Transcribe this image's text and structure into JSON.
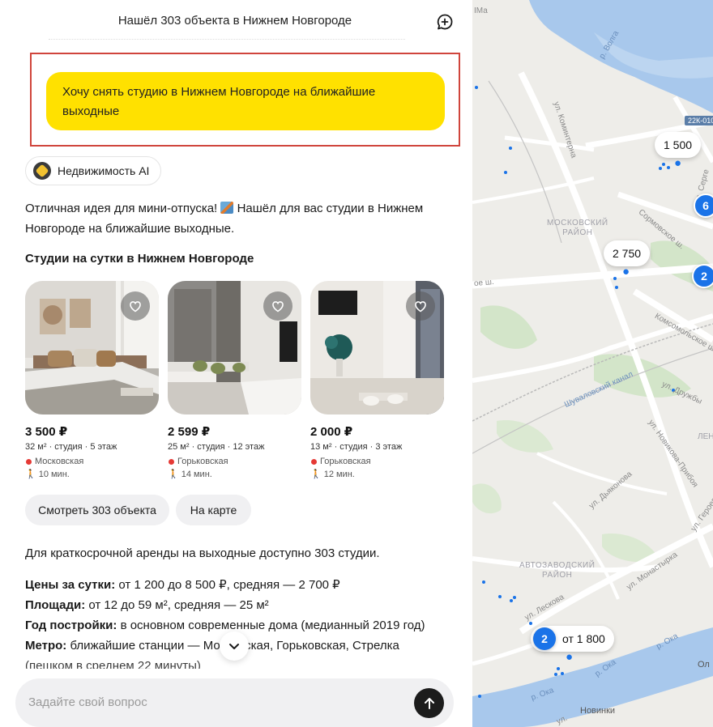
{
  "header": {
    "title": "Нашёл 303 объекта в Нижнем Новгороде"
  },
  "user_message": "Хочу снять студию в Нижнем Новгороде на ближайшие выходные",
  "source_chip": "Недвижимость AI",
  "assistant": {
    "intro_before_emoji": "Отличная идея для мини-отпуска!",
    "intro_after_emoji": "Нашёл для вас студии в Нижнем Новгороде на ближайшие выходные.",
    "section_title": "Студии на сутки в Нижнем Новгороде"
  },
  "listings": [
    {
      "price": "3 500 ₽",
      "meta": "32 м² · студия · 5 этаж",
      "metro": "Московская",
      "walk": "10 мин."
    },
    {
      "price": "2 599 ₽",
      "meta": "25 м² · студия · 12 этаж",
      "metro": "Горьковская",
      "walk": "14 мин."
    },
    {
      "price": "2 000 ₽",
      "meta": "13 м² · студия · 3 этаж",
      "metro": "Горьковская",
      "walk": "12 мин."
    }
  ],
  "actions": {
    "view_all": "Смотреть 303 объекта",
    "on_map": "На карте"
  },
  "summary": {
    "intro": "Для краткосрочной аренды на выходные доступно 303 студии.",
    "prices_label": "Цены за сутки:",
    "prices_value": " от 1 200 до 8 500 ₽, средняя — 2 700 ₽",
    "area_label": "Площади:",
    "area_value": " от 12 до 59 м², средняя — 25 м²",
    "year_label": "Год постройки:",
    "year_value": " в основном современные дома (медианный 2019 год)",
    "metro_label": "Метро:",
    "metro_value": " ближайшие станции — Московская, Горьковская, Стрелка",
    "metro_cont": "(пешком в среднем 22 минуты)"
  },
  "input": {
    "placeholder": "Задайте свой вопрос"
  },
  "map": {
    "labels": {
      "top_left": "ІМа",
      "volga": "р. Волга",
      "kominterna": "ул. Коминтерна",
      "road_code": "22К-010",
      "sergievskaya": "ул. Серге",
      "district_moskovsky": "МОСКОВСКИЙ\nРАЙОН",
      "sormovskoe": "Сормовское ш.",
      "sh_left": "ое ш.",
      "komsomolskoe": "Комсомольское ш.",
      "shuvalovsky": "Шуваловский канал",
      "druzhby": "ул. Дружбы",
      "novikova": "ул. Новикова-Прибоя",
      "len": "ЛЕН",
      "dyakonova": "ул. Дьяконова",
      "geroev": "ул. Героев",
      "district_avtozavodsky": "АВТОЗАВОДСКИЙ\nРАЙОН",
      "monastyrka": "ул. Монастырка",
      "leskova": "ул. Лескова",
      "oka_1": "р. Ока",
      "oka_2": "р. Ока",
      "oka_3": "р. Ока",
      "ol": "Ол",
      "novinki": "Новинки",
      "ul_bottom": "ул."
    },
    "price_pins": [
      "1 500",
      "2 750",
      "от 1 800"
    ],
    "clusters": [
      "6",
      "2",
      "2"
    ],
    "colors": {
      "water": "#a8c8ec",
      "green": "#cfe3c6",
      "pin": "#1a73e8"
    }
  },
  "colors": {
    "accent_yellow": "#ffe100",
    "highlight_border": "#d0453c",
    "metro_red": "#e53935"
  }
}
